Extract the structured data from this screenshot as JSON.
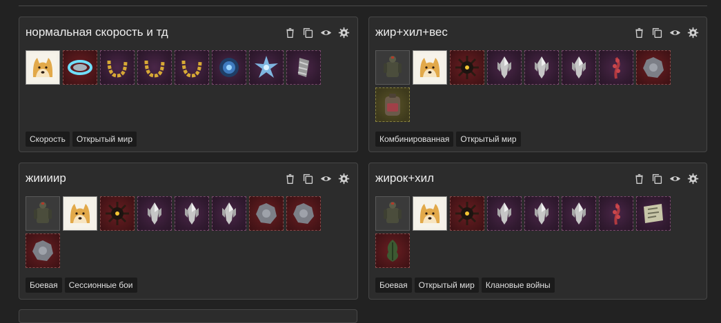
{
  "builds": [
    {
      "title": "нормальная скорость и тд",
      "items": [
        {
          "icon": "doge-avatar-icon",
          "bg": "doge"
        },
        {
          "icon": "energy-ring-artifact-icon",
          "bg": "red"
        },
        {
          "icon": "golden-horseshoe-artifact-icon",
          "bg": "purple"
        },
        {
          "icon": "golden-horseshoe-artifact-icon",
          "bg": "purple"
        },
        {
          "icon": "golden-horseshoe-artifact-icon",
          "bg": "purple"
        },
        {
          "icon": "blue-sphere-artifact-icon",
          "bg": "purple"
        },
        {
          "icon": "blue-crystal-artifact-icon",
          "bg": "purple"
        },
        {
          "icon": "twisted-stone-artifact-icon",
          "bg": "purple"
        }
      ],
      "tags": [
        "Скорость",
        "Открытый мир"
      ]
    },
    {
      "title": "жир+хил+вес",
      "items": [
        {
          "icon": "armor-suit-icon",
          "bg": "grey"
        },
        {
          "icon": "doge-avatar-icon",
          "bg": "doge"
        },
        {
          "icon": "spiked-mine-artifact-icon",
          "bg": "red"
        },
        {
          "icon": "silver-crystal-artifact-icon",
          "bg": "purple"
        },
        {
          "icon": "silver-crystal-artifact-icon",
          "bg": "purple"
        },
        {
          "icon": "silver-crystal-artifact-icon",
          "bg": "purple"
        },
        {
          "icon": "red-coral-artifact-icon",
          "bg": "purple"
        },
        {
          "icon": "grey-stone-artifact-icon",
          "bg": "red"
        },
        {
          "icon": "backpack-icon",
          "bg": "gold"
        }
      ],
      "tags": [
        "Комбинированная",
        "Открытый мир"
      ]
    },
    {
      "title": "жиииир",
      "items": [
        {
          "icon": "armor-suit-icon",
          "bg": "grey"
        },
        {
          "icon": "doge-avatar-icon",
          "bg": "doge"
        },
        {
          "icon": "spiked-mine-artifact-icon",
          "bg": "red"
        },
        {
          "icon": "silver-crystal-artifact-icon",
          "bg": "purple"
        },
        {
          "icon": "silver-crystal-artifact-icon",
          "bg": "purple"
        },
        {
          "icon": "silver-crystal-artifact-icon",
          "bg": "purple"
        },
        {
          "icon": "grey-stone-artifact-icon",
          "bg": "red"
        },
        {
          "icon": "grey-stone-artifact-icon",
          "bg": "red"
        },
        {
          "icon": "grey-stone-artifact-icon",
          "bg": "red"
        }
      ],
      "tags": [
        "Боевая",
        "Сессионные бои"
      ]
    },
    {
      "title": "жирок+хил",
      "items": [
        {
          "icon": "armor-suit-icon",
          "bg": "grey"
        },
        {
          "icon": "doge-avatar-icon",
          "bg": "doge"
        },
        {
          "icon": "spiked-mine-artifact-icon",
          "bg": "red"
        },
        {
          "icon": "silver-crystal-artifact-icon",
          "bg": "purple"
        },
        {
          "icon": "silver-crystal-artifact-icon",
          "bg": "purple"
        },
        {
          "icon": "silver-crystal-artifact-icon",
          "bg": "purple"
        },
        {
          "icon": "red-coral-artifact-icon",
          "bg": "purple"
        },
        {
          "icon": "map-scroll-icon",
          "bg": "purple"
        },
        {
          "icon": "green-moss-artifact-icon",
          "bg": "red"
        }
      ],
      "tags": [
        "Боевая",
        "Открытый мир",
        "Клановые войны"
      ]
    }
  ],
  "action_icons": [
    "trash-icon",
    "copy-icon",
    "eye-icon",
    "gear-icon"
  ]
}
